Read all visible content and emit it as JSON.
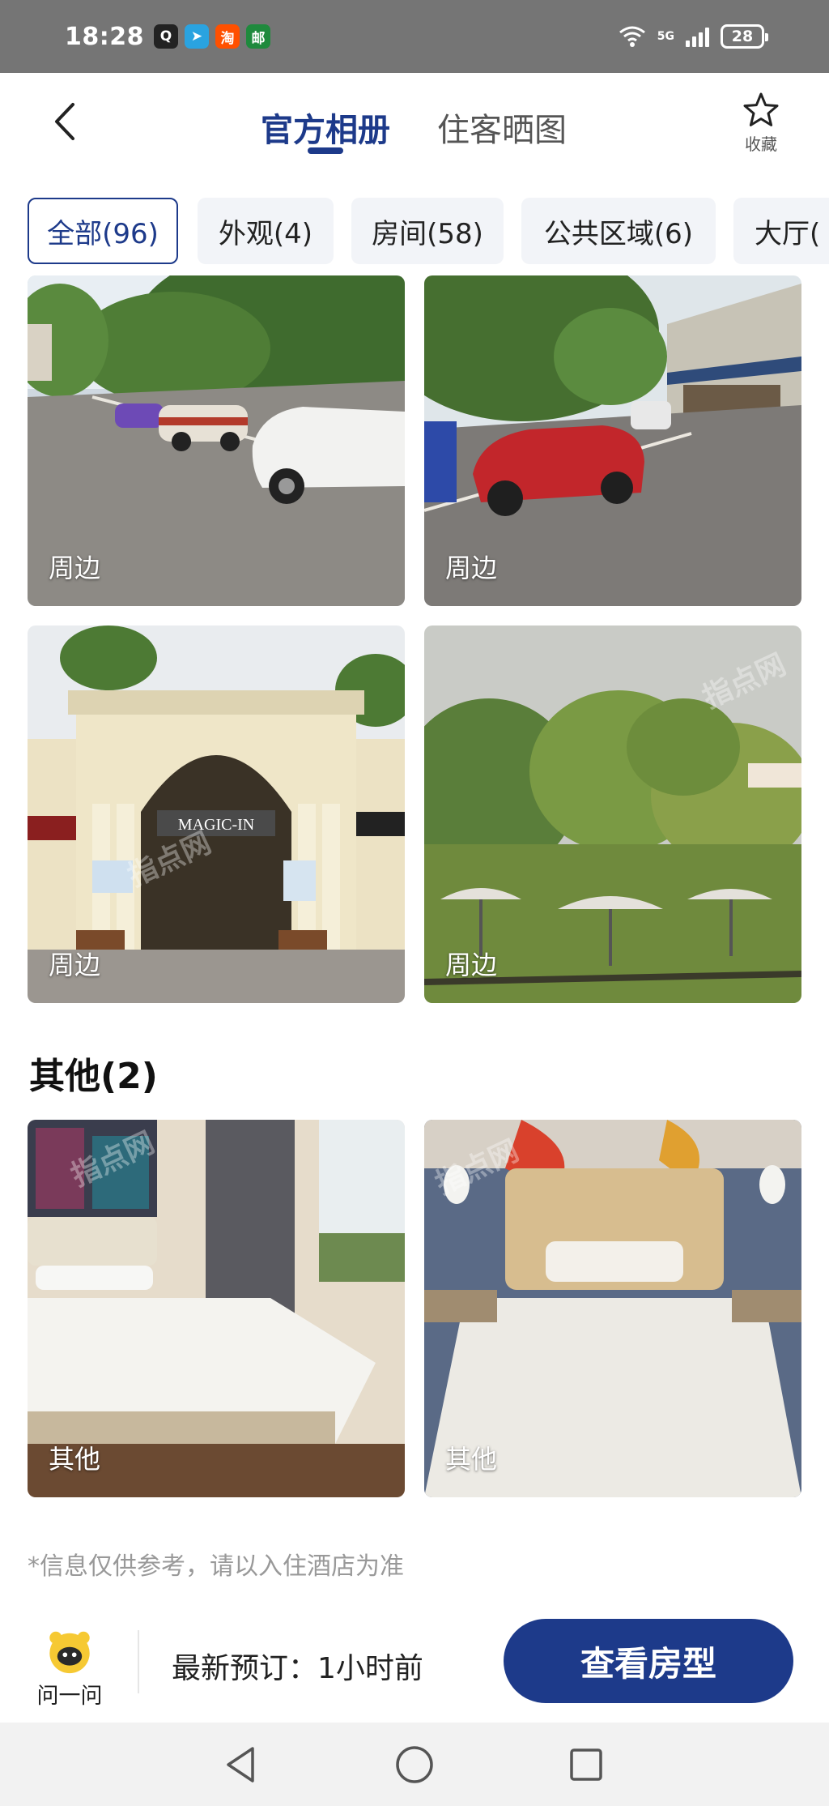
{
  "status_bar": {
    "time": "18:28",
    "network": "5G",
    "battery": "28",
    "app_icons": [
      {
        "name": "qq-icon",
        "glyph": "Q",
        "color": "#222222"
      },
      {
        "name": "telegram-icon",
        "glyph": "➤",
        "color": "#2aa3e0"
      },
      {
        "name": "taobao-icon",
        "glyph": "淘",
        "color": "#ff5000"
      },
      {
        "name": "china-post-icon",
        "glyph": "邮",
        "color": "#1f8a3d"
      }
    ]
  },
  "header": {
    "tabs": [
      {
        "label": "官方相册",
        "active": true
      },
      {
        "label": "住客晒图",
        "active": false
      }
    ],
    "favorite_label": "收藏"
  },
  "filters": [
    {
      "label": "全部(96)",
      "active": true
    },
    {
      "label": "外观(4)",
      "active": false
    },
    {
      "label": "房间(58)",
      "active": false
    },
    {
      "label": "公共区域(6)",
      "active": false
    },
    {
      "label": "大厅(",
      "active": false
    }
  ],
  "photos_top": [
    {
      "label": "周边",
      "scene": "street-parking-left"
    },
    {
      "label": "周边",
      "scene": "street-parking-right"
    },
    {
      "label": "周边",
      "scene": "hotel-entrance"
    },
    {
      "label": "周边",
      "scene": "garden-umbrellas"
    }
  ],
  "hotel_sign_text": "MAGIC-IN",
  "watermark_text": "指点网",
  "section_other": {
    "title": "其他(2)",
    "photos": [
      {
        "label": "其他",
        "scene": "bedroom-window"
      },
      {
        "label": "其他",
        "scene": "bedroom-headboard"
      }
    ]
  },
  "disclaimer": "*信息仅供参考，请以入住酒店为准",
  "bottom_bar": {
    "ask_label": "问一问",
    "latest_booking": "最新预订：1小时前",
    "cta_label": "查看房型"
  },
  "colors": {
    "brand": "#1d3a8a",
    "chip_bg": "#f2f4f8",
    "status_bar": "#757575"
  }
}
